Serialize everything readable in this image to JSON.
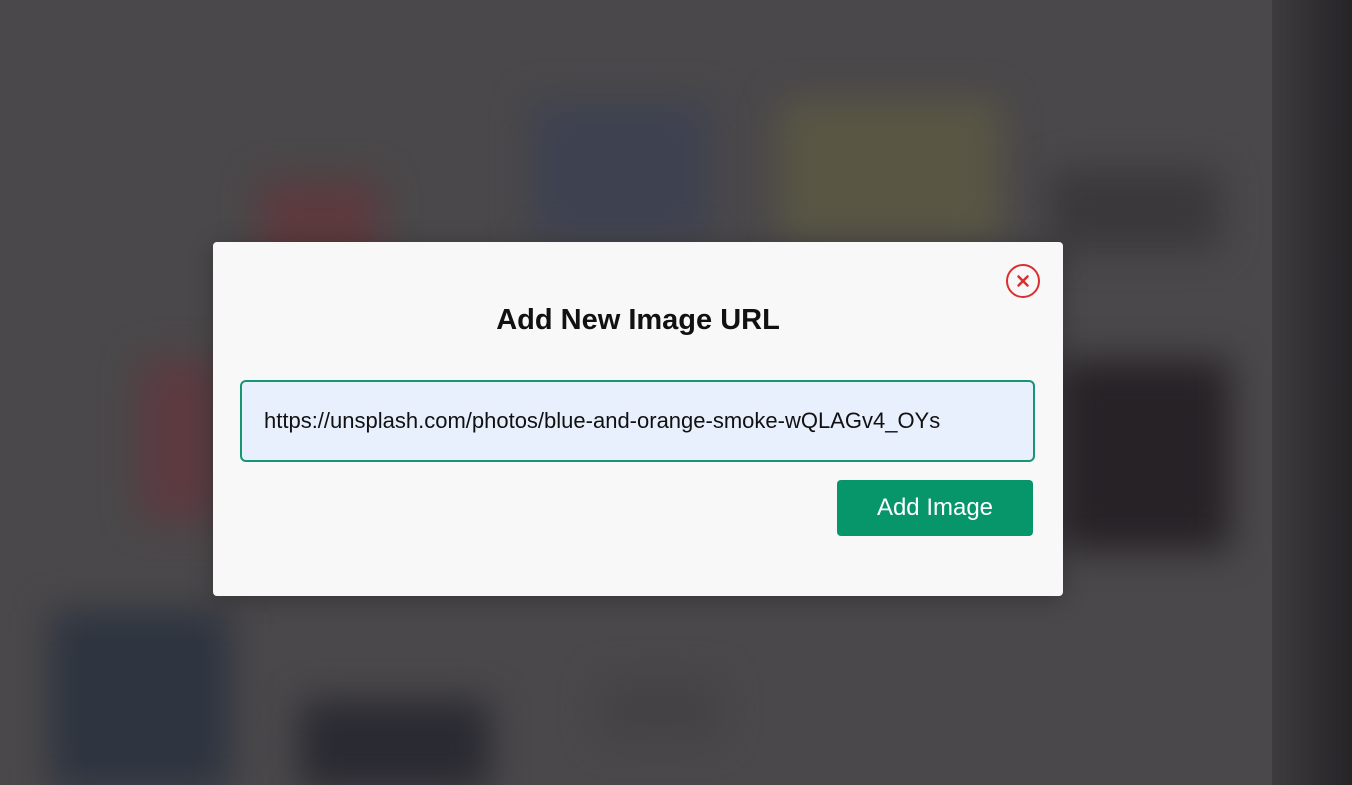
{
  "modal": {
    "title": "Add New Image URL",
    "url_input": {
      "value": "https://unsplash.com/photos/blue-and-orange-smoke-wQLAGv4_OYs",
      "placeholder": ""
    },
    "add_button_label": "Add Image",
    "close_icon": "close-icon"
  },
  "colors": {
    "accent_green": "#07966a",
    "input_border": "#169672",
    "input_bg": "#e8f0fe",
    "close_red": "#d9302f",
    "overlay": "#4a484a"
  }
}
